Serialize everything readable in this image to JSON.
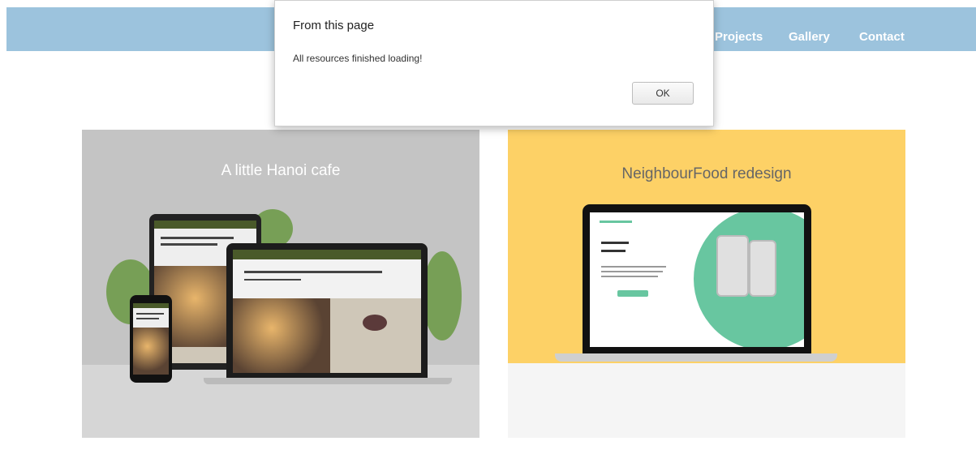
{
  "nav": {
    "items": [
      "Projects",
      "Gallery",
      "Contact"
    ]
  },
  "dialog": {
    "title": "From this page",
    "message": "All resources finished loading!",
    "ok_label": "OK"
  },
  "cards": [
    {
      "title": "A little Hanoi cafe"
    },
    {
      "title": "NeighbourFood redesign"
    }
  ],
  "colors": {
    "navbar": "#9cc3dd",
    "card_yellow": "#fdd166",
    "accent_green": "#68c6a0"
  }
}
